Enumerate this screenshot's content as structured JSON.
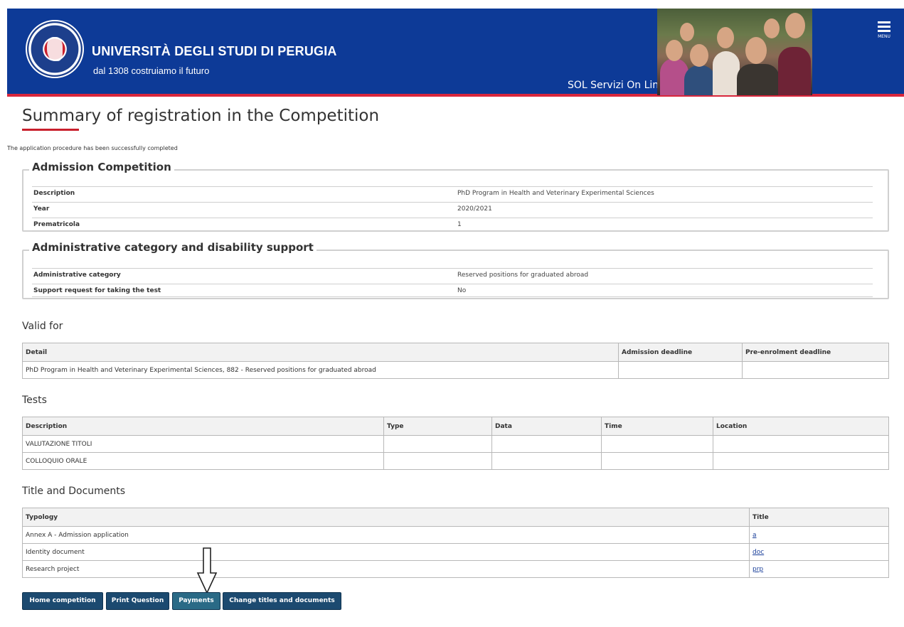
{
  "header": {
    "university_name": "UNIVERSITÀ DEGLI STUDI DI PERUGIA",
    "tagline": "dal 1308 costruiamo il futuro",
    "service_name": "SOL Servizi On Line",
    "menu_label": "MENU",
    "colors": {
      "band": "#0d3a97",
      "accent": "#d9263c"
    }
  },
  "page": {
    "title": "Summary of registration in the Competition",
    "status_message": "The application procedure has been successfully completed"
  },
  "admission": {
    "legend": "Admission Competition",
    "rows": [
      {
        "label": "Description",
        "value": "PhD Program in Health and Veterinary Experimental Sciences"
      },
      {
        "label": "Year",
        "value": "2020/2021"
      },
      {
        "label": "Prematricola",
        "value": "1"
      }
    ]
  },
  "admin_category": {
    "legend": "Administrative category and disability support",
    "rows": [
      {
        "label": "Administrative category",
        "value": "Reserved positions for graduated abroad"
      },
      {
        "label": "Support request for taking the test",
        "value": "No"
      }
    ]
  },
  "valid_for": {
    "heading": "Valid for",
    "columns": [
      "Detail",
      "Admission deadline",
      "Pre-enrolment deadline"
    ],
    "rows": [
      [
        "PhD Program in Health and Veterinary Experimental Sciences, 882 - Reserved positions for graduated abroad",
        "",
        ""
      ]
    ]
  },
  "tests": {
    "heading": "Tests",
    "columns": [
      "Description",
      "Type",
      "Data",
      "Time",
      "Location"
    ],
    "rows": [
      [
        "VALUTAZIONE TITOLI",
        "",
        "",
        "",
        ""
      ],
      [
        "COLLOQUIO ORALE",
        "",
        "",
        "",
        ""
      ]
    ]
  },
  "documents": {
    "heading": "Title and Documents",
    "columns": [
      "Typology",
      "Title"
    ],
    "rows": [
      [
        "Annex A - Admission application",
        "a"
      ],
      [
        "Identity document",
        "doc"
      ],
      [
        "Research project",
        "prp"
      ]
    ]
  },
  "actions": {
    "home": "Home competition",
    "print": "Print Question",
    "payments": "Payments",
    "change": "Change titles and documents",
    "button_color": "#1c4a70"
  }
}
